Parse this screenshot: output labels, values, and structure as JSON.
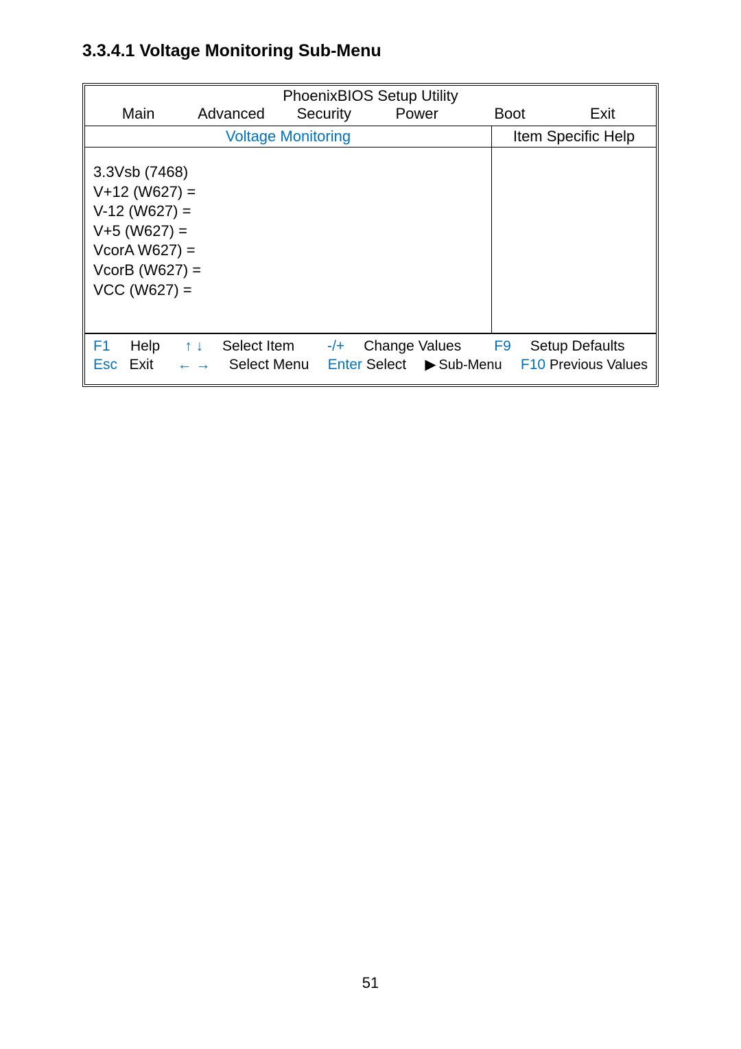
{
  "section_title": "3.3.4.1 Voltage Monitoring Sub-Menu",
  "bios": {
    "utility_title": "PhoenixBIOS Setup Utility",
    "menu": {
      "main": "Main",
      "advanced": "Advanced",
      "security": "Security",
      "power": "Power",
      "boot": "Boot",
      "exit": "Exit"
    },
    "subheader_left": "Voltage Monitoring",
    "subheader_right": "Item Specific Help",
    "readings": [
      "3.3Vsb (7468)",
      "V+12 (W627) =",
      "V-12 (W627) =",
      "V+5 (W627) =",
      "VcorA W627) =",
      "VcorB (W627) =",
      "VCC (W627) ="
    ],
    "footer": {
      "line1": {
        "k1": "F1",
        "t1": "Help",
        "arrows1": "↑ ↓",
        "t2": "Select Item",
        "k2": "-/+",
        "t3": "Change Values",
        "k3": "F9",
        "t4": "Setup Defaults"
      },
      "line2": {
        "k1": "Esc",
        "t1": "Exit",
        "arrows1": "← →",
        "t2": "Select Menu",
        "k2": "Enter",
        "t3": "Select",
        "tri": "▶",
        "t4": "Sub-Menu",
        "k3": "F10",
        "t5": "Previous Values"
      }
    }
  },
  "page_number": "51"
}
